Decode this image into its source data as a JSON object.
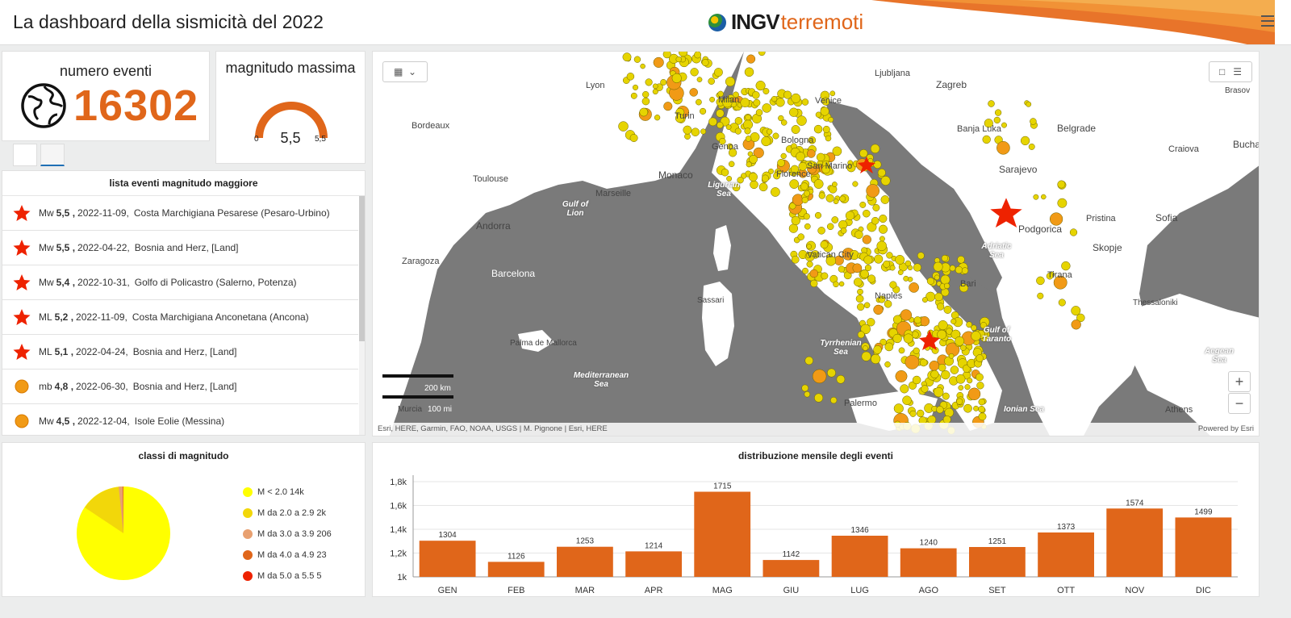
{
  "header": {
    "title": "La dashboard della sismicità del 2022",
    "logo_ingv": "INGV",
    "logo_terremoti": "terremoti",
    "menu_icon": "hamburger-icon"
  },
  "event_count": {
    "title": "numero eventi",
    "value": "16302",
    "icon": "globe-icon"
  },
  "max_magnitude": {
    "title": "magnitudo massima",
    "value": "5,5",
    "min": "0",
    "max": "5,5",
    "fill_fraction": 1.0,
    "color": "#e0661a"
  },
  "event_list": {
    "title": "lista eventi magnitudo maggiore",
    "rows": [
      {
        "type": "Mw",
        "mag": "5,5 ,",
        "date": "2022-11-09,",
        "place": "Costa Marchigiana Pesarese (Pesaro-Urbino)",
        "icon": "star"
      },
      {
        "type": "Mw",
        "mag": "5,5 ,",
        "date": "2022-04-22,",
        "place": "Bosnia and Herz, [Land]",
        "icon": "star"
      },
      {
        "type": "Mw",
        "mag": "5,4 ,",
        "date": "2022-10-31,",
        "place": "Golfo di Policastro (Salerno, Potenza)",
        "icon": "star"
      },
      {
        "type": "ML",
        "mag": "5,2 ,",
        "date": "2022-11-09,",
        "place": "Costa Marchigiana Anconetana (Ancona)",
        "icon": "star"
      },
      {
        "type": "ML",
        "mag": "5,1 ,",
        "date": "2022-04-24,",
        "place": "Bosnia and Herz, [Land]",
        "icon": "star"
      },
      {
        "type": "mb",
        "mag": "4,8 ,",
        "date": "2022-06-30,",
        "place": "Bosnia and Herz, [Land]",
        "icon": "circle"
      },
      {
        "type": "Mw",
        "mag": "4,5 ,",
        "date": "2022-12-04,",
        "place": "Isole Eolie (Messina)",
        "icon": "circle"
      }
    ]
  },
  "map": {
    "labels": [
      "Lyon",
      "Bordeaux",
      "Toulouse",
      "Andorra",
      "Zaragoza",
      "Barcelona",
      "Monaco",
      "Marseille",
      "Milan",
      "Turin",
      "Genoa",
      "Bologna",
      "Florence",
      "San Marino",
      "Venice",
      "Ljubljana",
      "Zagreb",
      "Banja Luka",
      "Belgrade",
      "Sarajevo",
      "Podgorica",
      "Pristina",
      "Sofia",
      "Skopje",
      "Tirana",
      "Bari",
      "Naples",
      "Vatican City",
      "Sassari",
      "Palermo",
      "Craiova",
      "Bucha",
      "Brasov",
      "Thessaloniki",
      "Athens",
      "Murcia"
    ],
    "seas": [
      "Gulf of Lion",
      "Ligurian Sea",
      "Adriatic Sea",
      "Tyrrhenian Sea",
      "Mediterranean Sea",
      "Gulf of Taranto",
      "Ionian Sea",
      "Aegean Sea",
      "Palma de Mallorca"
    ],
    "scale_km": "200 km",
    "scale_mi": "100 mi",
    "scale_zero": "0",
    "attribution": "Esri, HERE, Garmin, FAO, NOAA, USGS | M. Pignone | Esri, HERE",
    "powered": "Powered by Esri",
    "zoom_in": "+",
    "zoom_out": "−"
  },
  "magnitude_classes": {
    "title": "classi di magnitudo",
    "legend": [
      {
        "label": "M < 2.0  14k",
        "color": "#ffff00"
      },
      {
        "label": "M da 2.0 a 2.9  2k",
        "color": "#f2d70a"
      },
      {
        "label": "M da 3.0 a 3.9  206",
        "color": "#e8a070"
      },
      {
        "label": "M da 4.0 a 4.9  23",
        "color": "#e0661a"
      },
      {
        "label": "M da 5.0 a 5.5  5",
        "color": "#ee2200"
      }
    ]
  },
  "chart_data": {
    "type": "bar",
    "title": "distribuzione mensile degli eventi",
    "categories": [
      "GEN",
      "FEB",
      "MAR",
      "APR",
      "MAG",
      "GIU",
      "LUG",
      "AGO",
      "SET",
      "OTT",
      "NOV",
      "DIC"
    ],
    "values": [
      1304,
      1126,
      1253,
      1214,
      1715,
      1142,
      1346,
      1240,
      1251,
      1373,
      1574,
      1499
    ],
    "yticks": [
      "1k",
      "1,2k",
      "1,4k",
      "1,6k",
      "1,8k"
    ],
    "ylim": [
      1000,
      1800
    ],
    "color": "#e0661a",
    "grid": true
  }
}
